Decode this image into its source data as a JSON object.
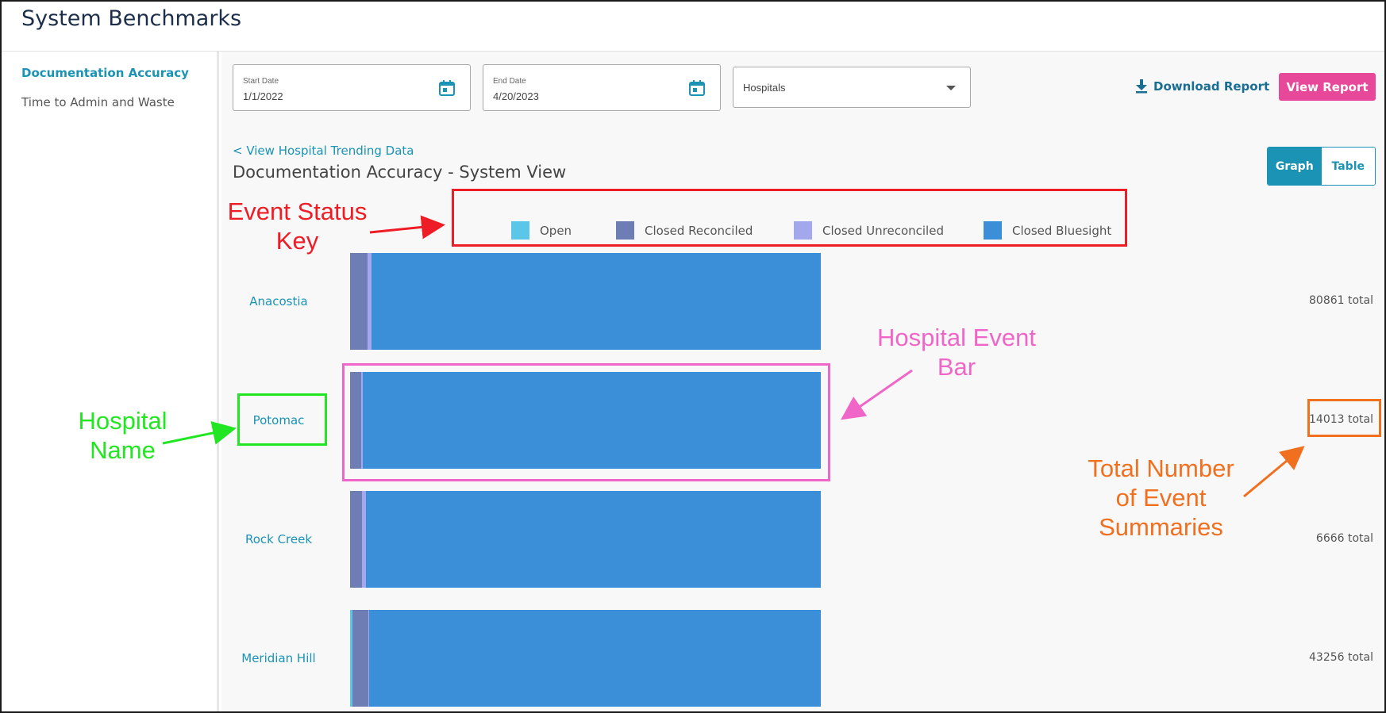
{
  "app": {
    "title": "System Benchmarks"
  },
  "sidebar": {
    "items": [
      {
        "label": "Documentation Accuracy",
        "active": true
      },
      {
        "label": "Time to Admin and Waste",
        "active": false
      }
    ]
  },
  "filters": {
    "start_date": {
      "label": "Start Date",
      "value": "1/1/2022"
    },
    "end_date": {
      "label": "End Date",
      "value": "4/20/2023"
    },
    "hospitals": {
      "value": "Hospitals"
    }
  },
  "actions": {
    "download_label": "Download Report",
    "view_report_label": "View Report"
  },
  "view": {
    "back_link": "< View Hospital Trending Data",
    "title": "Documentation Accuracy - System View",
    "toggle": {
      "graph": "Graph",
      "table": "Table",
      "selected": "Graph"
    }
  },
  "colors": {
    "open": "#5bc6e8",
    "closed_reconciled": "#6f7db5",
    "closed_unreconciled": "#a3a7ec",
    "closed_bluesight": "#3b8fd8",
    "accent": "#1a93b4",
    "button": "#e8489a"
  },
  "chart_data": {
    "type": "bar",
    "orientation": "horizontal-stacked-100",
    "legend": [
      {
        "name": "Open",
        "color": "#5bc6e8"
      },
      {
        "name": "Closed Reconciled",
        "color": "#6f7db5"
      },
      {
        "name": "Closed Unreconciled",
        "color": "#a3a7ec"
      },
      {
        "name": "Closed Bluesight",
        "color": "#3b8fd8"
      }
    ],
    "categories": [
      "Anacostia",
      "Potomac",
      "Rock Creek",
      "Meridian Hill"
    ],
    "totals": [
      "80861 total",
      "14013 total",
      "6666 total",
      "43256 total"
    ],
    "series": [
      {
        "name": "Open",
        "values": [
          0.0,
          0.0,
          0.0,
          0.5
        ]
      },
      {
        "name": "Closed Reconciled",
        "values": [
          3.7,
          2.3,
          2.6,
          3.3
        ]
      },
      {
        "name": "Closed Unreconciled",
        "values": [
          0.8,
          0.4,
          0.8,
          0.3
        ]
      },
      {
        "name": "Closed Bluesight",
        "values": [
          95.5,
          97.3,
          96.6,
          95.9
        ]
      }
    ]
  },
  "annotations": {
    "event_status_key": "Event Status Key",
    "hospital_name": "Hospital Name",
    "hospital_event_bar": "Hospital Event Bar",
    "total_events": "Total Number of Event Summaries"
  }
}
